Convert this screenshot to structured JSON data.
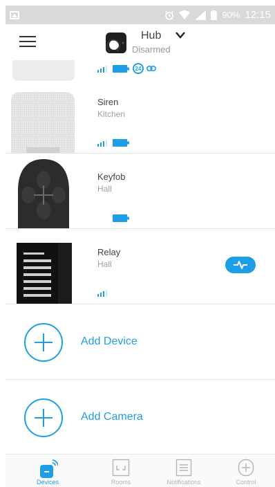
{
  "statusbar": {
    "battery_percent": "90%",
    "time": "12:15",
    "icons": [
      "gallery-icon",
      "alarm-icon",
      "wifi-icon",
      "cell-signal-icon",
      "battery-icon"
    ]
  },
  "header": {
    "hub_name": "Hub",
    "hub_status": "Disarmed",
    "icons": [
      "menu-icon",
      "hub-icon",
      "chevron-down-icon"
    ]
  },
  "devices": [
    {
      "name": "",
      "room": "",
      "badge": "24",
      "icons": [
        "signal-icon",
        "battery-icon",
        "link-icon"
      ]
    },
    {
      "name": "Siren",
      "room": "Kitchen",
      "icons": [
        "signal-icon",
        "battery-icon"
      ]
    },
    {
      "name": "Keyfob",
      "room": "Hall",
      "icons": [
        "battery-icon"
      ]
    },
    {
      "name": "Relay",
      "room": "Hall",
      "icons": [
        "signal-icon",
        "pulse-icon"
      ]
    }
  ],
  "add_device": {
    "label": "Add Device",
    "icon": "plus-circle-icon"
  },
  "add_camera": {
    "label": "Add Camera",
    "icon": "plus-circle-icon"
  },
  "nav": [
    {
      "label": "Devices",
      "icon": "devices-icon",
      "active": true
    },
    {
      "label": "Rooms",
      "icon": "rooms-icon",
      "active": false
    },
    {
      "label": "Notifications",
      "icon": "notifications-icon",
      "active": false
    },
    {
      "label": "Control",
      "icon": "control-icon",
      "active": false
    }
  ],
  "colors": {
    "accent": "#1e9ee6",
    "statusbar": "#d9d9d9",
    "divider": "#e3e3e3",
    "inactive_nav": "#b5b5b5"
  }
}
